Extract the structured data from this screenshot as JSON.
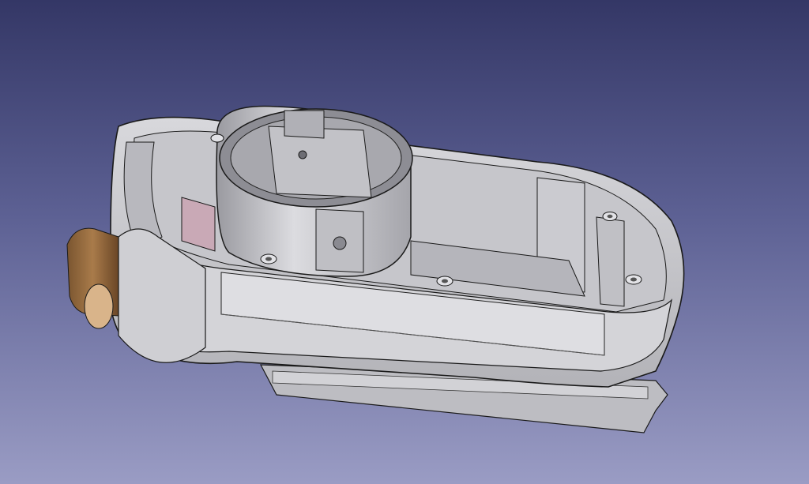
{
  "viewport": {
    "background_top": "#343766",
    "background_bottom": "#9a9cc4"
  },
  "model": {
    "body_color": "#c9c9cd",
    "shadow_color": "#8f8f96",
    "edge_color": "#1a1a1a",
    "accent_pink": "#c9a9b6",
    "accent_wood": "#9a6a3a",
    "parts": [
      "outer-shell",
      "cylindrical-housing",
      "battery-roll",
      "screw-holes",
      "bottom-rail"
    ]
  }
}
